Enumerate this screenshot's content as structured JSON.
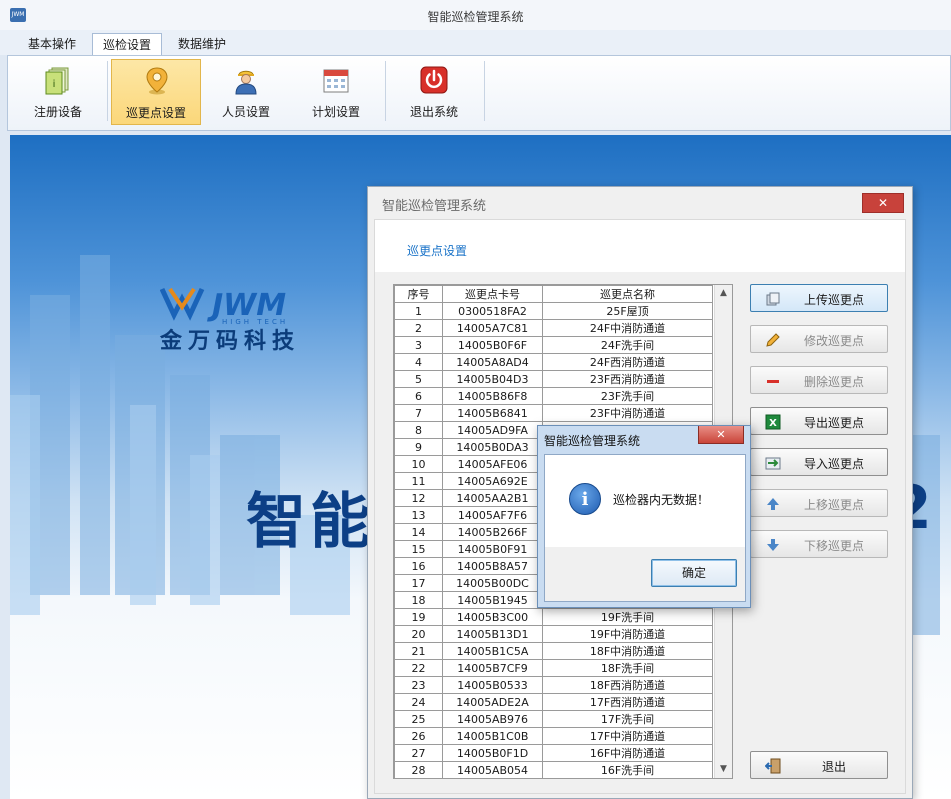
{
  "app": {
    "title": "智能巡检管理系统",
    "icon_label": "JWM"
  },
  "tabs": [
    {
      "label": "基本操作"
    },
    {
      "label": "巡检设置",
      "active": true
    },
    {
      "label": "数据维护"
    }
  ],
  "ribbon": {
    "buttons": [
      {
        "label": "注册设备",
        "icon": "register-device-icon"
      },
      {
        "label": "巡更点设置",
        "icon": "location-pin-icon",
        "active": true
      },
      {
        "label": "人员设置",
        "icon": "worker-icon"
      },
      {
        "label": "计划设置",
        "icon": "calendar-icon"
      },
      {
        "label": "退出系统",
        "icon": "power-icon"
      }
    ]
  },
  "background": {
    "logo_text": "JWM",
    "logo_subtext": "HIGH TECH",
    "logo_cn": "金万码科技",
    "big_text": "智能",
    "big_text_right": "2"
  },
  "dialog": {
    "title": "智能巡检管理系统",
    "close_label": "✕",
    "heading": "巡更点设置",
    "table": {
      "columns": [
        "序号",
        "巡更点卡号",
        "巡更点名称"
      ],
      "rows": [
        [
          "1",
          "0300518FA2",
          "25F屋顶"
        ],
        [
          "2",
          "14005A7C81",
          "24F中消防通道"
        ],
        [
          "3",
          "14005B0F6F",
          "24F洗手间"
        ],
        [
          "4",
          "14005A8AD4",
          "24F西消防通道"
        ],
        [
          "5",
          "14005B04D3",
          "23F西消防通道"
        ],
        [
          "6",
          "14005B86F8",
          "23F洗手间"
        ],
        [
          "7",
          "14005B6841",
          "23F中消防通道"
        ],
        [
          "8",
          "14005AD9FA",
          ""
        ],
        [
          "9",
          "14005B0DA3",
          ""
        ],
        [
          "10",
          "14005AFE06",
          ""
        ],
        [
          "11",
          "14005A692E",
          ""
        ],
        [
          "12",
          "14005AA2B1",
          ""
        ],
        [
          "13",
          "14005AF7F6",
          ""
        ],
        [
          "14",
          "14005B266F",
          ""
        ],
        [
          "15",
          "14005B0F91",
          ""
        ],
        [
          "16",
          "14005B8A57",
          ""
        ],
        [
          "17",
          "14005B00DC",
          ""
        ],
        [
          "18",
          "14005B1945",
          ""
        ],
        [
          "19",
          "14005B3C00",
          "19F洗手间"
        ],
        [
          "20",
          "14005B13D1",
          "19F中消防通道"
        ],
        [
          "21",
          "14005B1C5A",
          "18F中消防通道"
        ],
        [
          "22",
          "14005B7CF9",
          "18F洗手间"
        ],
        [
          "23",
          "14005B0533",
          "18F西消防通道"
        ],
        [
          "24",
          "14005ADE2A",
          "17F西消防通道"
        ],
        [
          "25",
          "14005AB976",
          "17F洗手间"
        ],
        [
          "26",
          "14005B1C0B",
          "17F中消防通道"
        ],
        [
          "27",
          "14005B0F1D",
          "16F中消防通道"
        ],
        [
          "28",
          "14005AB054",
          "16F洗手间"
        ]
      ]
    },
    "buttons": [
      {
        "label": "上传巡更点",
        "icon": "upload-icon",
        "enabled": true,
        "primary": true
      },
      {
        "label": "修改巡更点",
        "icon": "pencil-icon",
        "enabled": false
      },
      {
        "label": "删除巡更点",
        "icon": "minus-icon",
        "enabled": false
      },
      {
        "label": "导出巡更点",
        "icon": "excel-icon",
        "enabled": true
      },
      {
        "label": "导入巡更点",
        "icon": "import-icon",
        "enabled": true
      },
      {
        "label": "上移巡更点",
        "icon": "arrow-up-icon",
        "enabled": false
      },
      {
        "label": "下移巡更点",
        "icon": "arrow-down-icon",
        "enabled": false
      },
      {
        "label": "退出",
        "icon": "exit-door-icon",
        "enabled": true
      }
    ]
  },
  "message_box": {
    "title": "智能巡检管理系统",
    "close_label": "✕",
    "icon": "info-icon",
    "text": "巡检器内无数据！",
    "ok_label": "确定"
  },
  "colors": {
    "accent": "#1a73c8",
    "active_ribbon": "#fbd77a",
    "close_red": "#c8423b",
    "banner_blue": "#0c3f86"
  }
}
